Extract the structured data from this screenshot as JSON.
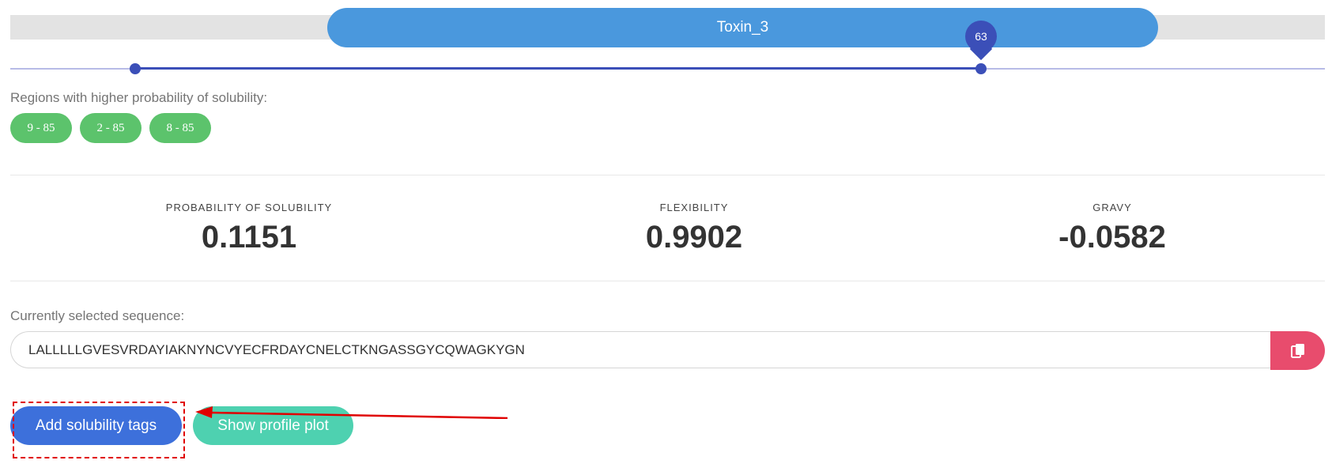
{
  "domain_selector": {
    "label": "Toxin_3"
  },
  "slider": {
    "tooltip_value": "63"
  },
  "regions": {
    "label": "Regions with higher probability of solubility:",
    "chips": [
      "9 - 85",
      "2 - 85",
      "8 - 85"
    ]
  },
  "stats": [
    {
      "label": "PROBABILITY OF SOLUBILITY",
      "value": "0.1151"
    },
    {
      "label": "FLEXIBILITY",
      "value": "0.9902"
    },
    {
      "label": "GRAVY",
      "value": "-0.0582"
    }
  ],
  "sequence": {
    "label": "Currently selected sequence:",
    "value": "LALLLLLGVESVRDAYIAKNYNCVYECFRDAYCNELCTKNGASSGYCQWAGKYGN"
  },
  "copy_button": {
    "icon": "copy-icon"
  },
  "buttons": {
    "add_tags": "Add solubility tags",
    "show_plot": "Show profile plot"
  },
  "colors": {
    "domain_pill": "#4a98dd",
    "slider": "#3b4fb8",
    "chip": "#5cc36c",
    "copy_button": "#e84c6d",
    "add_button": "#3d70db",
    "plot_button": "#4ed1b0",
    "annotation": "#e00000"
  }
}
